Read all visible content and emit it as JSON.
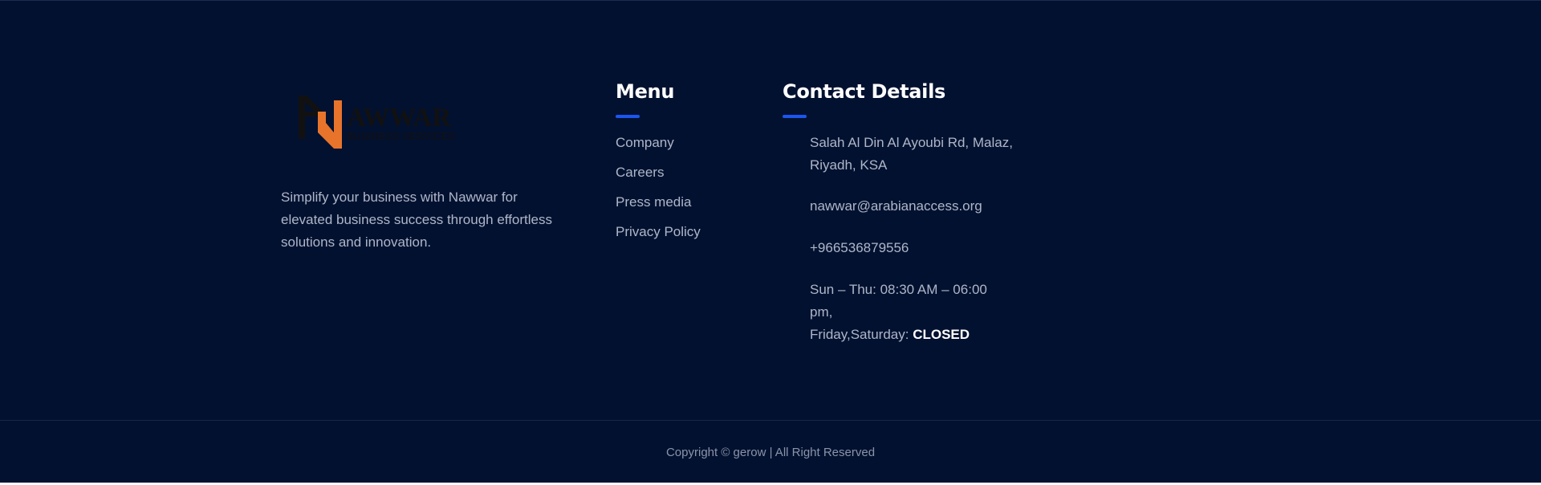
{
  "brand": {
    "logo_text_main": "AWWAR",
    "logo_text_sub": "BUSINESS SERVICES",
    "logo_colors": {
      "dark": "#111111",
      "accent": "#e8742c"
    },
    "tagline": "Simplify your business with Nawwar for elevated business success through effortless solutions and innovation."
  },
  "menu": {
    "heading": "Menu",
    "items": [
      {
        "label": "Company"
      },
      {
        "label": "Careers"
      },
      {
        "label": "Press media"
      },
      {
        "label": "Privacy Policy"
      }
    ]
  },
  "contact": {
    "heading": "Contact Details",
    "address_line1": "Salah Al Din Al Ayoubi Rd, Malaz,",
    "address_line2": "Riyadh, KSA",
    "email": "nawwar@arabianaccess.org",
    "phone": "+966536879556",
    "hours_line1": "Sun – Thu: 08:30 AM – 06:00",
    "hours_line2": "pm,",
    "hours_weekend_prefix": "Friday,Saturday:",
    "hours_weekend_status": "CLOSED"
  },
  "footer": {
    "copyright": "Copyright © gerow | All Right Reserved"
  },
  "colors": {
    "background": "#031130",
    "accent_bar": "#1a56f0",
    "text_muted": "#aeb6c8",
    "heading": "#ffffff"
  }
}
